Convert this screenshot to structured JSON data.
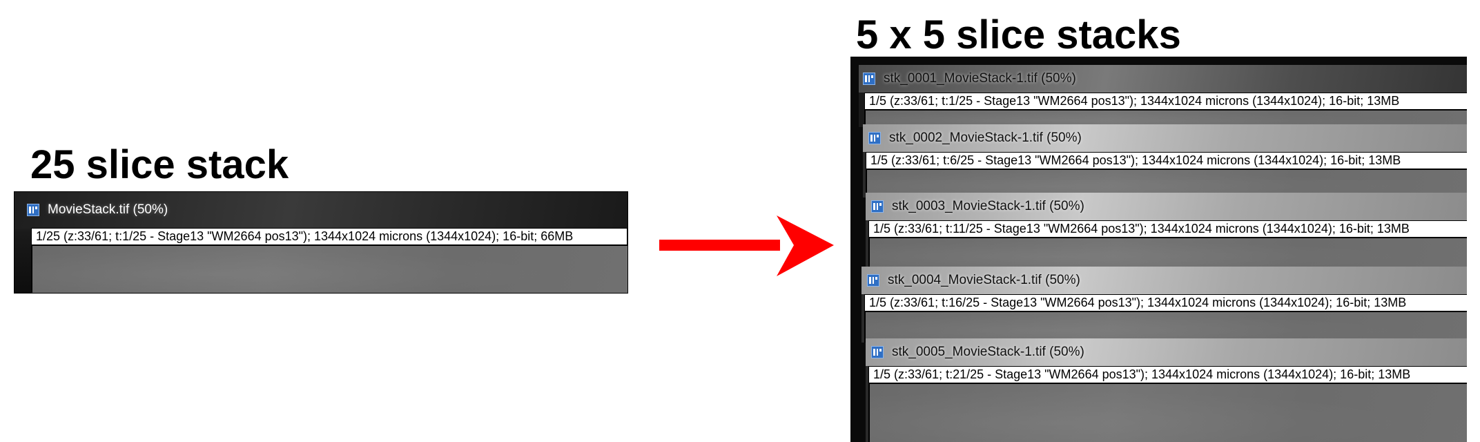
{
  "left_heading": "25 slice stack",
  "right_heading": "5 x 5 slice stacks",
  "original_window": {
    "title": "MovieStack.tif (50%)",
    "info": "1/25 (z:33/61; t:1/25 - Stage13 \"WM2664 pos13\"); 1344x1024 microns (1344x1024); 16-bit; 66MB",
    "icon": "imagej-image-icon"
  },
  "stacks": [
    {
      "title": "stk_0001_MovieStack-1.tif (50%)",
      "info": "1/5 (z:33/61; t:1/25 - Stage13 \"WM2664 pos13\"); 1344x1024 microns (1344x1024); 16-bit; 13MB"
    },
    {
      "title": "stk_0002_MovieStack-1.tif (50%)",
      "info": "1/5 (z:33/61; t:6/25 - Stage13 \"WM2664 pos13\"); 1344x1024 microns (1344x1024); 16-bit; 13MB"
    },
    {
      "title": "stk_0003_MovieStack-1.tif (50%)",
      "info": "1/5 (z:33/61; t:11/25 - Stage13 \"WM2664 pos13\"); 1344x1024 microns (1344x1024); 16-bit; 13MB"
    },
    {
      "title": "stk_0004_MovieStack-1.tif (50%)",
      "info": "1/5 (z:33/61; t:16/25 - Stage13 \"WM2664 pos13\"); 1344x1024 microns (1344x1024); 16-bit; 13MB"
    },
    {
      "title": "stk_0005_MovieStack-1.tif (50%)",
      "info": "1/5 (z:33/61; t:21/25 - Stage13 \"WM2664 pos13\"); 1344x1024 microns (1344x1024); 16-bit; 13MB"
    }
  ],
  "arrow": {
    "color": "#ff0000",
    "icon": "right-arrow-icon"
  },
  "icon_color": "#2f6fc4"
}
